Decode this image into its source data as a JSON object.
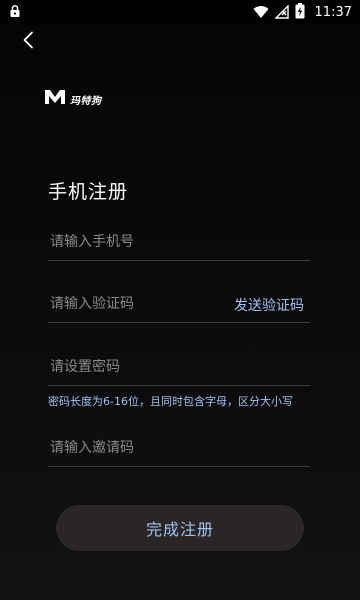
{
  "status_bar": {
    "time": "11:37",
    "icons": [
      "lock-icon",
      "wifi-icon",
      "signal-icon",
      "battery-charging-icon"
    ]
  },
  "header": {
    "back_icon": "chevron-left-icon"
  },
  "brand": {
    "name": "玛特狗"
  },
  "page": {
    "title": "手机注册"
  },
  "form": {
    "phone_placeholder": "请输入手机号",
    "code_placeholder": "请输入验证码",
    "send_code_label": "发送验证码",
    "password_placeholder": "请设置密码",
    "password_hint": "密码长度为6-16位，且同时包含字母，区分大小写",
    "invite_placeholder": "请输入邀请码",
    "submit_label": "完成注册"
  },
  "colors": {
    "background": "#000000",
    "accent_text": "#9fc3f0",
    "button_bg": "#2a2626",
    "divider": "#3a3a3d",
    "placeholder": "#8a8a8e"
  }
}
